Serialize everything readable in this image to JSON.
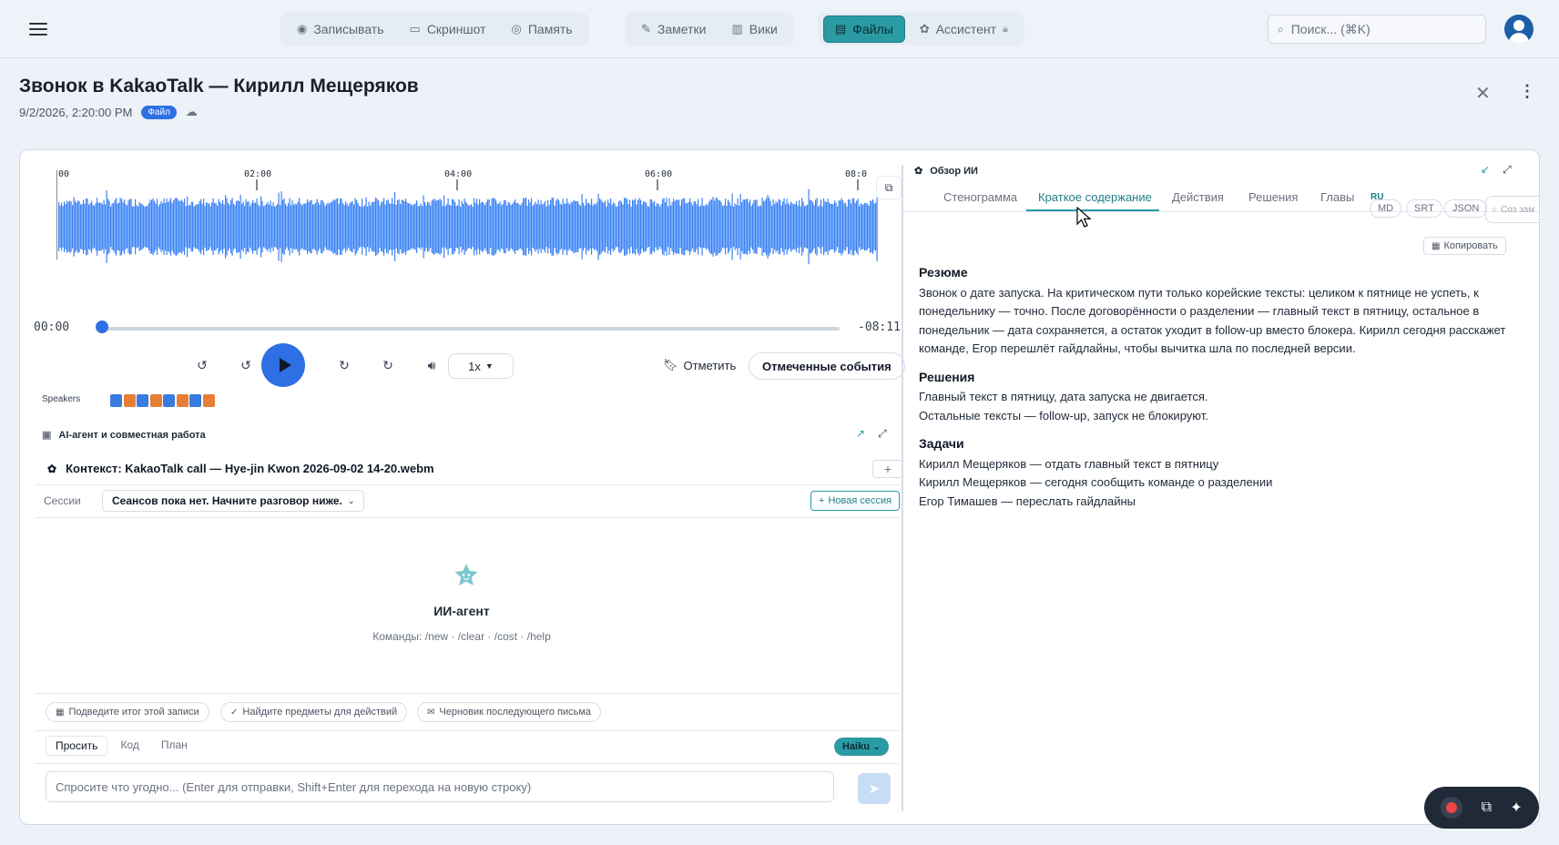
{
  "nav": {
    "groups": [
      [
        {
          "label": "Записывать",
          "icon": "record-icon"
        },
        {
          "label": "Скриншот",
          "icon": "screenshot-icon"
        },
        {
          "label": "Память",
          "icon": "memory-icon"
        }
      ],
      [
        {
          "label": "Заметки",
          "icon": "notes-icon"
        },
        {
          "label": "Вики",
          "icon": "wiki-icon"
        }
      ],
      [
        {
          "label": "Файлы",
          "icon": "files-icon",
          "active": true
        },
        {
          "label": "Ассистент",
          "icon": "assistant-icon",
          "locked": true
        }
      ]
    ],
    "search_placeholder": "Поиск... (⌘K)"
  },
  "header": {
    "title": "Звонок в KakaoTalk — Кирилл Мещеряков",
    "datetime": "9/2/2026, 2:20:00 PM",
    "badge": "Файл"
  },
  "player": {
    "ticks": [
      "00",
      "02:00",
      "04:00",
      "06:00",
      "08:0"
    ],
    "current": "00:00",
    "remaining": "-08:11",
    "progress": 0,
    "speed": "1x",
    "mark_label": "Отметить",
    "marked_events_label": "Отмеченные события",
    "speakers_label": "Speakers",
    "speaker_colors": [
      "#3a7be0",
      "#e67e36",
      "#3a7be0",
      "#e67e36",
      "#3a7be0",
      "#e67e36",
      "#3a7be0",
      "#e67e36"
    ]
  },
  "agent": {
    "section_title": "AI-агент и совместная работа",
    "context": "Контекст: KakaoTalk call — Hye-jin Kwon 2026-09-02 14-20.webm",
    "sessions_label": "Сессии",
    "sessions_value": "Сеансов пока нет. Начните разговор ниже.",
    "new_session": "Новая сессия",
    "bot_title": "ИИ-агент",
    "commands": "Команды: /new · /clear · /cost · /help",
    "suggestions": [
      "Подведите итог этой записи",
      "Найдите предметы для действий",
      "Черновик последующего письма"
    ],
    "modes": [
      "Просить",
      "Код",
      "План"
    ],
    "model": "Haiku",
    "input_placeholder": "Спросите что угодно... (Enter для отправки, Shift+Enter для перехода на новую строку)"
  },
  "overview": {
    "title": "Обзор ИИ",
    "tabs": [
      "Стенограмма",
      "Краткое содержание",
      "Действия",
      "Решения",
      "Главы"
    ],
    "active_tab": "Краткое содержание",
    "lang": "RU",
    "formats": [
      "MD",
      "SRT",
      "JSON"
    ],
    "create_partial": "Соз зам",
    "copy": "Копировать",
    "summary_heading": "Резюме",
    "summary_text": "Звонок о дате запуска. На критическом пути только корейские тексты: целиком к пятнице не успеть, к понедельнику — точно. После договорённости о разделении — главный текст в пятницу, остальное в понедельник — дата сохраняется, а остаток уходит в follow-up вместо блокера. Кирилл сегодня расскажет команде, Егор перешлёт гайдлайны, чтобы вычитка шла по последней версии.",
    "decisions_heading": "Решения",
    "decisions": [
      "Главный текст в пятницу, дата запуска не двигается.",
      "Остальные тексты — follow-up, запуск не блокируют."
    ],
    "tasks_heading": "Задачи",
    "tasks": [
      "Кирилл Мещеряков — отдать главный текст в пятницу",
      "Кирилл Мещеряков — сегодня сообщить команде о разделении",
      "Егор Тимашев — переслать гайдлайны"
    ]
  },
  "colors": {
    "accent": "#2a9aa3",
    "primary": "#2f6fe4",
    "wave": "#3b82f6"
  }
}
